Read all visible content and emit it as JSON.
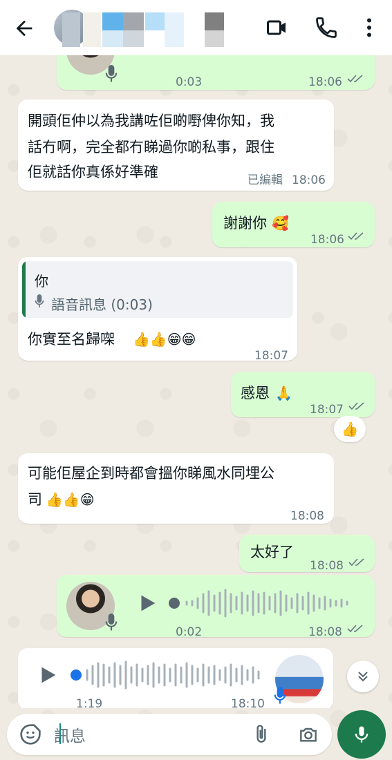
{
  "colors": {
    "accent": "#1c7a4c",
    "outgoing": "#d9fdd3",
    "incoming": "#ffffff",
    "tick": "#667781",
    "voice_dot": "#1a73e8"
  },
  "header": {
    "icons": [
      "back-arrow-icon",
      "video-call-icon",
      "phone-icon",
      "more-vert-icon"
    ]
  },
  "messages": {
    "voice1": {
      "duration": "0:03",
      "time": "18:06"
    },
    "m1": {
      "lines": [
        "開頭佢仲以為我講咗佢啲嘢俾你知，我",
        "話冇啊，完全都冇睇過你啲私事，跟住",
        "佢就話你真係好準確"
      ],
      "edited": "已編輯",
      "time": "18:06"
    },
    "m2": {
      "text": "謝謝你",
      "emoji": "🥰",
      "time": "18:06"
    },
    "m3": {
      "quote_author": "你",
      "quote_text": "語音訊息 (0:03)",
      "text": "你實至名歸㗎",
      "emoji": "👍👍😁😁",
      "time": "18:07"
    },
    "m4": {
      "text": "感恩",
      "emoji": "🙏",
      "time": "18:07",
      "reaction": "👍"
    },
    "m5": {
      "lines": [
        "可能佢屋企到時都會搵你睇風水同埋公",
        "司"
      ],
      "emoji": "👍👍😁",
      "time": "18:08"
    },
    "m6": {
      "text": "太好了",
      "time": "18:08"
    },
    "voice2": {
      "duration": "0:02",
      "time": "18:08"
    },
    "voice3": {
      "duration": "1:19",
      "time": "18:10"
    }
  },
  "composer": {
    "placeholder": "訊息"
  }
}
